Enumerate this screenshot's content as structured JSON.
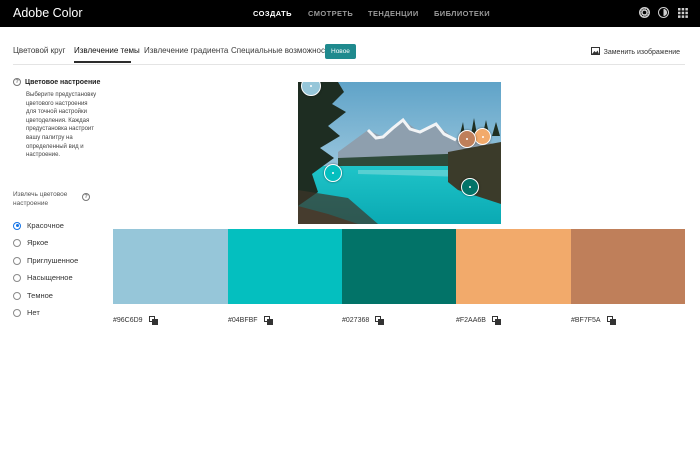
{
  "app": {
    "title": "Adobe Color"
  },
  "topnav": {
    "items": [
      {
        "label": "СОЗДАТЬ",
        "active": true
      },
      {
        "label": "СМОТРЕТЬ",
        "active": false
      },
      {
        "label": "ТЕНДЕНЦИИ",
        "active": false
      },
      {
        "label": "БИБЛИОТЕКИ",
        "active": false
      }
    ],
    "icons": [
      "settings-icon",
      "contrast-icon",
      "grid-icon"
    ]
  },
  "tabs": [
    {
      "label": "Цветовой круг",
      "active": false
    },
    {
      "label": "Извлечение темы",
      "active": true
    },
    {
      "label": "Извлечение градиента",
      "active": false
    },
    {
      "label": "Специальные возможности",
      "active": false
    }
  ],
  "badge": {
    "label": "Новое"
  },
  "replace_image": {
    "label": "Заменить изображение",
    "icon": "image-icon"
  },
  "sidebar": {
    "mood_title": "Цветовое настроение",
    "mood_description": "Выберите предустановку цветового настроения для точной настройки цветоделения. Каждая предустановка настроит вашу палитру на определенный вид и настроение.",
    "extract_label": "Извлечь цветовое настроение",
    "moods": [
      {
        "label": "Красочное",
        "checked": true
      },
      {
        "label": "Яркое",
        "checked": false
      },
      {
        "label": "Приглушенное",
        "checked": false
      },
      {
        "label": "Насыщенное",
        "checked": false
      },
      {
        "label": "Темное",
        "checked": false
      },
      {
        "label": "Нет",
        "checked": false
      }
    ]
  },
  "palette": [
    {
      "hex": "#96C6D9",
      "color": "#96C6D9"
    },
    {
      "hex": "#04BFBF",
      "color": "#04BFBF"
    },
    {
      "hex": "#027368",
      "color": "#027368"
    },
    {
      "hex": "#F2AA6B",
      "color": "#F2AA6B"
    },
    {
      "hex": "#BF7F5A",
      "color": "#BF7F5A"
    }
  ]
}
